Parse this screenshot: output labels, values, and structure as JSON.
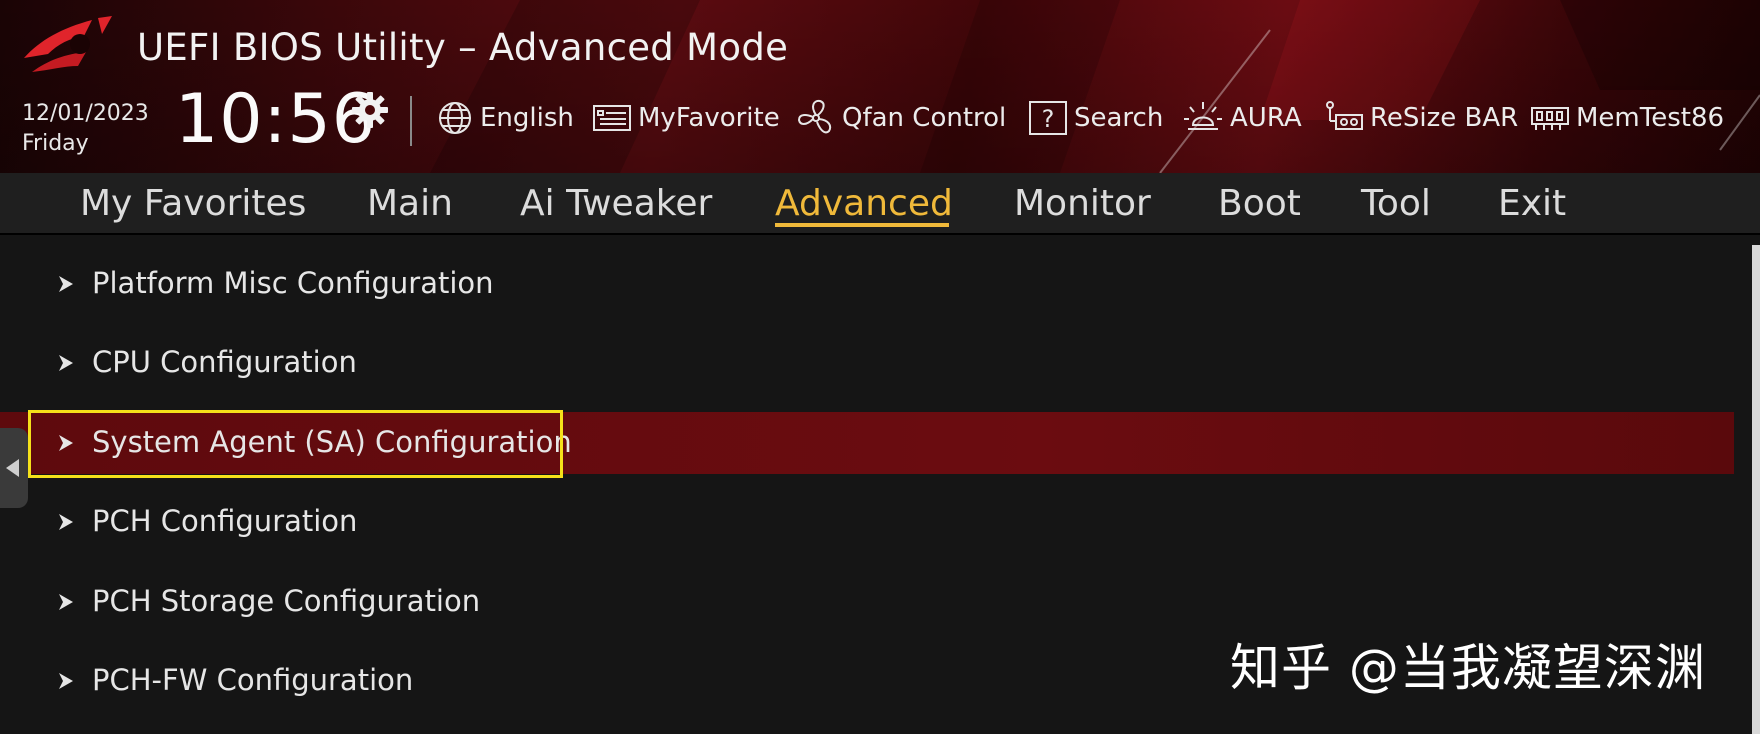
{
  "header": {
    "logo_icon": "rog-eye-logo",
    "title": "UEFI BIOS Utility – Advanced Mode",
    "date": "12/01/2023",
    "day": "Friday",
    "time": "10:56",
    "settings_icon": "gear-icon"
  },
  "toolbar": [
    {
      "label": "English",
      "icon": "globe-icon"
    },
    {
      "label": "MyFavorite",
      "icon": "myfavorite-icon"
    },
    {
      "label": "Qfan Control",
      "icon": "fan-icon"
    },
    {
      "label": "Search",
      "icon": "question-search-icon"
    },
    {
      "label": "AURA",
      "icon": "aura-light-icon"
    },
    {
      "label": "ReSize BAR",
      "icon": "resize-bar-icon"
    },
    {
      "label": "MemTest86",
      "icon": "memory-icon"
    }
  ],
  "nav": {
    "tabs": [
      "My Favorites",
      "Main",
      "Ai Tweaker",
      "Advanced",
      "Monitor",
      "Boot",
      "Tool",
      "Exit"
    ],
    "active": "Advanced"
  },
  "menu": {
    "items": [
      "Platform Misc Configuration",
      "CPU Configuration",
      "System Agent (SA) Configuration",
      "PCH Configuration",
      "PCH Storage Configuration",
      "PCH-FW Configuration"
    ],
    "selected": "System Agent (SA) Configuration"
  },
  "watermark": "知乎 @当我凝望深渊",
  "colors": {
    "accent": "#f0b93a",
    "selection": "#6b0c10",
    "highlight_box": "#f5e11a",
    "header_red": "#5a0b10"
  }
}
